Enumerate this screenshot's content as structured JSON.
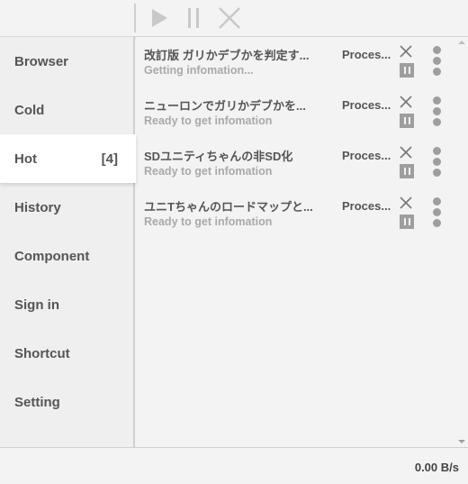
{
  "toolbar": {
    "icons": [
      "play-icon",
      "pause-icon",
      "close-icon"
    ],
    "icon_color": "#c8c8c8"
  },
  "sidebar": {
    "items": [
      {
        "label": "Browser"
      },
      {
        "label": "Cold"
      },
      {
        "label": "Hot",
        "badge": "[4]",
        "active": true
      },
      {
        "label": "History"
      },
      {
        "label": "Component"
      },
      {
        "label": "Sign in"
      },
      {
        "label": "Shortcut"
      },
      {
        "label": "Setting"
      }
    ]
  },
  "downloads": [
    {
      "title": "改訂版 ガリかデブかを判定す...",
      "status": "Getting infomation...",
      "process": "Proces..."
    },
    {
      "title": "ニューロンでガリかデブかを...",
      "status": "Ready to get infomation",
      "process": "Proces..."
    },
    {
      "title": "SDユニティちゃんの非SD化",
      "status": "Ready to get infomation",
      "process": "Proces..."
    },
    {
      "title": "ユニTちゃんのロードマップと...",
      "status": "Ready to get infomation",
      "process": "Proces..."
    }
  ],
  "statusbar": {
    "speed": "0.00 B/s"
  },
  "colors": {
    "background": "#f3f3f3",
    "active_item": "#ffffff",
    "text": "#555555",
    "muted_text": "#a9a9a9",
    "icon_gray": "#9e9e9e"
  }
}
